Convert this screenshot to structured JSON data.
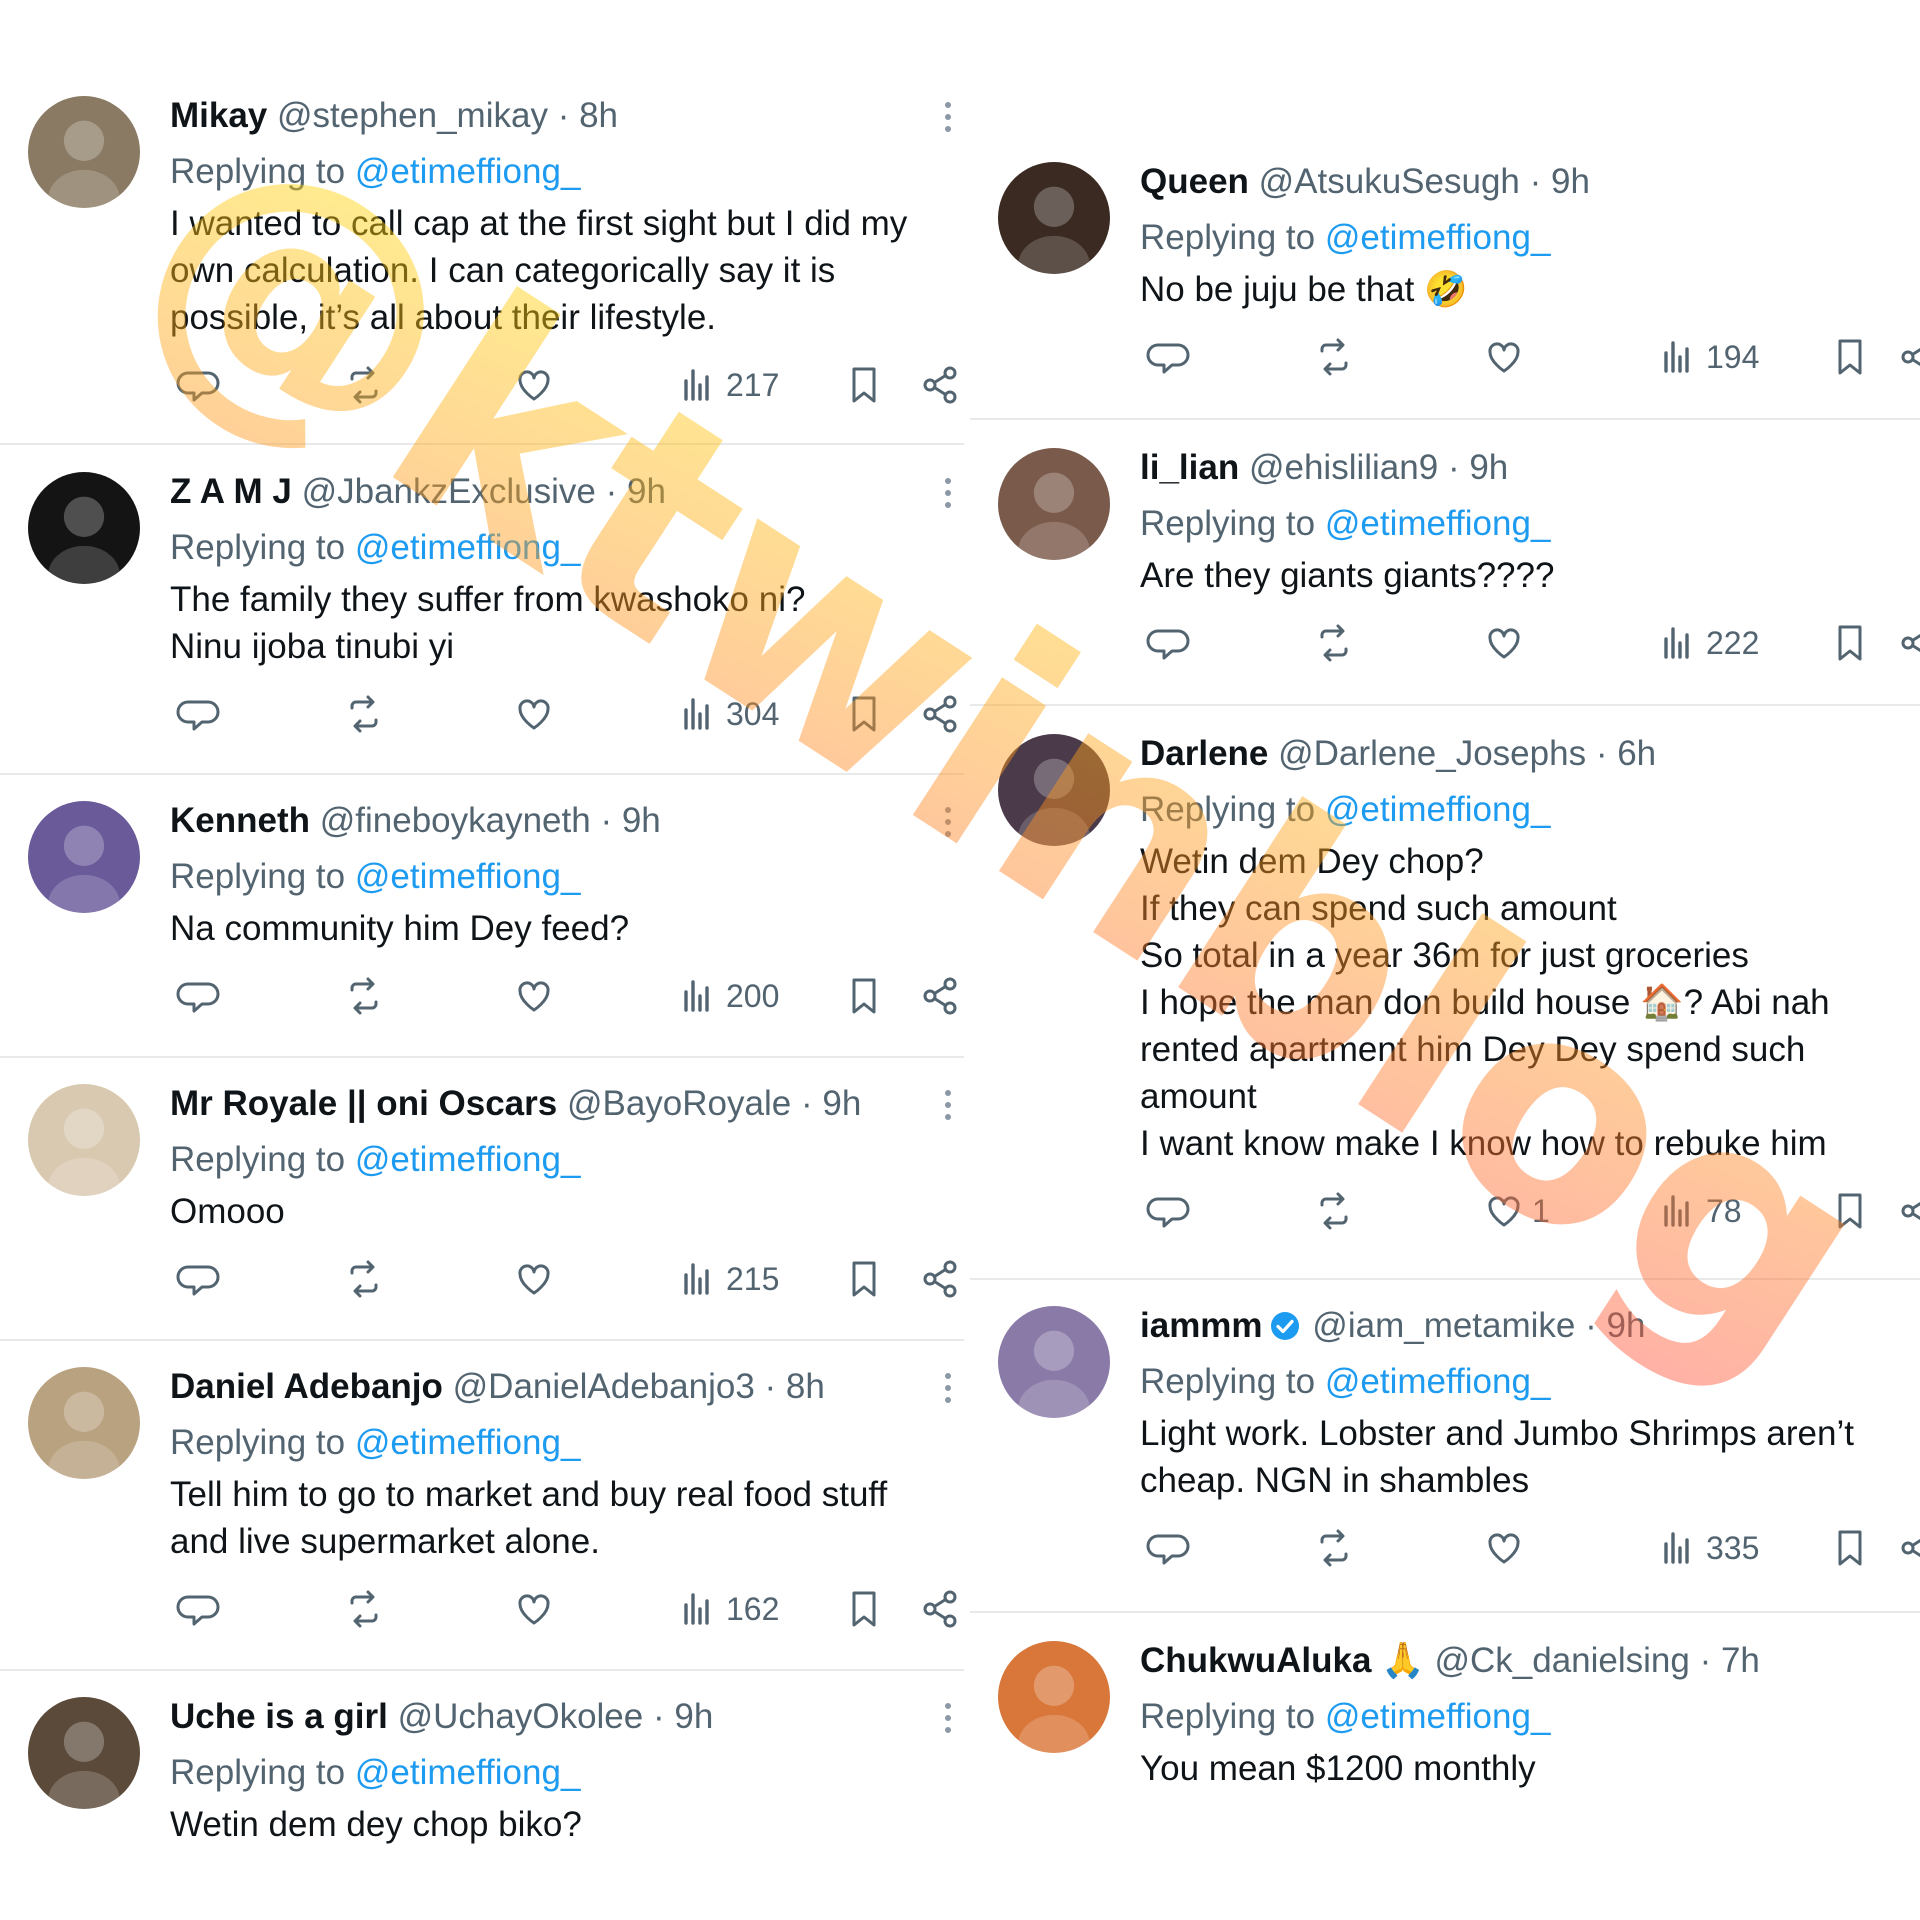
{
  "reply_prefix": "Replying to",
  "colors": {
    "link": "#1d9bf0",
    "muted": "#536471",
    "text": "#0f1419",
    "watermark_yellow": "#ffe600",
    "watermark_orange": "#ff9a1a",
    "watermark_red": "#ff4d3a",
    "verified": "#1d9bf0"
  },
  "watermark": {
    "text": "@ktwinblog"
  },
  "left_tweets": [
    {
      "name": "Mikay",
      "handle": "@stephen_mikay",
      "sep": "·",
      "time": "8h",
      "reply_to": "@etimeffiong_",
      "lines": [
        "I wanted to call cap at the first sight but I did my",
        "own calculation. I can categorically say it is",
        "possible, it’s all about their lifestyle."
      ],
      "likes": "",
      "views": "217",
      "avatar_color": "#8a7a63"
    },
    {
      "name": "Z A M J",
      "handle": "@JbankzExclusive",
      "sep": "·",
      "time": "9h",
      "reply_to": "@etimeffiong_",
      "lines": [
        "The family they suffer from kwashoko ni?",
        "Ninu ijoba tinubi yi"
      ],
      "likes": "",
      "views": "304",
      "avatar_color": "#141414"
    },
    {
      "name": "Kenneth",
      "handle": "@fineboykayneth",
      "sep": "·",
      "time": "9h",
      "reply_to": "@etimeffiong_",
      "lines": [
        "Na community him Dey feed?"
      ],
      "likes": "",
      "views": "200",
      "avatar_color": "#6a5a9a"
    },
    {
      "name": "Mr Royale || oni Oscars",
      "handle": "@BayoRoyale",
      "sep": "·",
      "time": "9h",
      "reply_to": "@etimeffiong_",
      "lines": [
        "Omooo"
      ],
      "likes": "",
      "views": "215",
      "avatar_color": "#d9c9b0"
    },
    {
      "name": "Daniel Adebanjo",
      "handle": "@DanielAdebanjo3",
      "sep": "·",
      "time": "8h",
      "reply_to": "@etimeffiong_",
      "lines": [
        "Tell him to go to market and buy real food stuff",
        "and live supermarket alone."
      ],
      "likes": "",
      "views": "162",
      "avatar_color": "#b9a27f"
    },
    {
      "name": "Uche is a girl",
      "handle": "@UchayOkolee",
      "sep": "·",
      "time": "9h",
      "reply_to": "@etimeffiong_",
      "lines": [
        "Wetin dem dey chop biko?"
      ],
      "likes": "",
      "views": "",
      "avatar_color": "#5b4a3a"
    }
  ],
  "right_tweets": [
    {
      "name": "Queen",
      "handle": "@AtsukuSesugh",
      "sep": "·",
      "time": "9h",
      "reply_to": "@etimeffiong_",
      "lines": [
        "No be juju be that 🤣"
      ],
      "likes": "",
      "views": "194",
      "avatar_color": "#3a2a22"
    },
    {
      "name": "li_lian",
      "handle": "@ehislilian9",
      "sep": "·",
      "time": "9h",
      "reply_to": "@etimeffiong_",
      "lines": [
        "Are they giants giants????"
      ],
      "likes": "",
      "views": "222",
      "avatar_color": "#7a5a4a"
    },
    {
      "name": "Darlene",
      "handle": "@Darlene_Josephs",
      "sep": "·",
      "time": "6h",
      "reply_to": "@etimeffiong_",
      "lines": [
        "Wetin dem Dey chop?",
        "If they can spend such amount",
        "So total in a year 36m for just groceries",
        " I hope the man don build house 🏠? Abi nah",
        "rented apartment him Dey Dey spend such",
        "amount",
        "I want know make I know how to rebuke him"
      ],
      "likes": "1",
      "views": "78",
      "avatar_color": "#4a3a4a"
    },
    {
      "name": "iammm",
      "handle": "@iam_metamike",
      "sep": "·",
      "time": "9h",
      "reply_to": "@etimeffiong_",
      "lines": [
        "Light work. Lobster and Jumbo Shrimps aren’t",
        "cheap. NGN in shambles"
      ],
      "likes": "",
      "views": "335",
      "avatar_color": "#8a7aa8",
      "verified": true
    },
    {
      "name": "ChukwuAluka 🙏",
      "handle": "@Ck_danielsing",
      "sep": "·",
      "time": "7h",
      "reply_to": "@etimeffiong_",
      "lines": [
        "You mean $1200 monthly"
      ],
      "likes": "",
      "views": "",
      "avatar_color": "#d9773a"
    }
  ]
}
